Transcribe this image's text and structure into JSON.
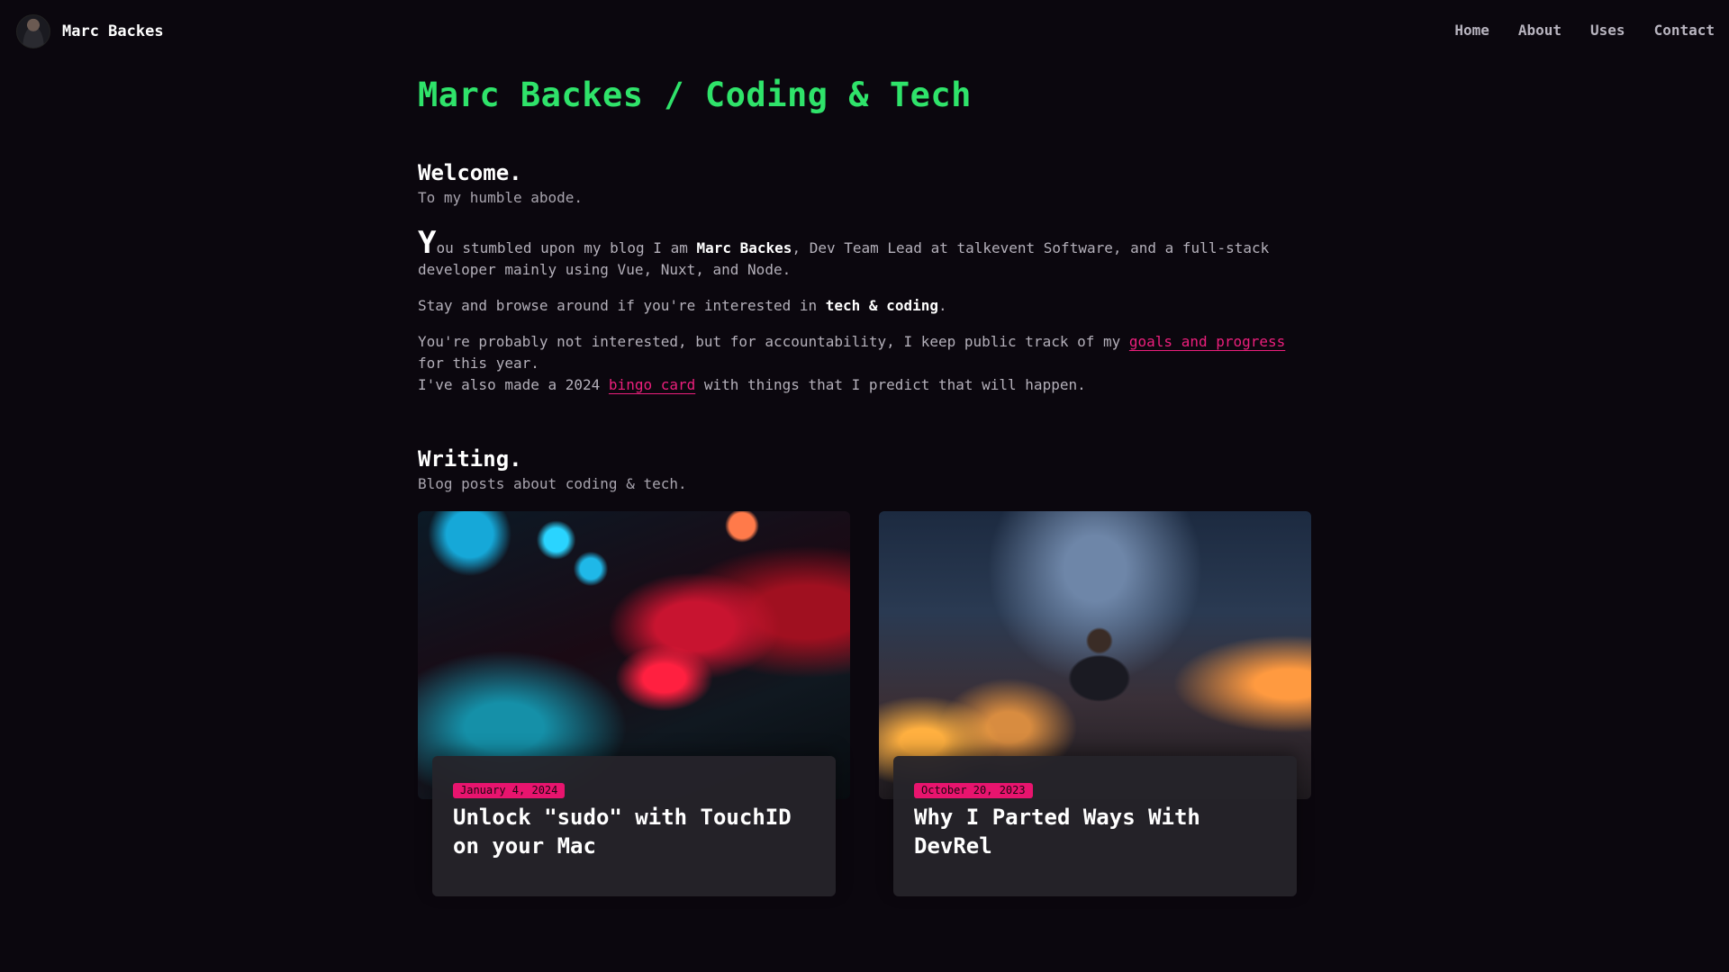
{
  "nav": {
    "brand_name": "Marc Backes",
    "links": [
      {
        "label": "Home"
      },
      {
        "label": "About"
      },
      {
        "label": "Uses"
      },
      {
        "label": "Contact"
      }
    ]
  },
  "header": {
    "title": "Marc Backes / Coding & Tech"
  },
  "welcome": {
    "title": "Welcome.",
    "subtitle": "To my humble abode."
  },
  "intro": {
    "dropcap": "Y",
    "p1_start": "ou stumbled upon my blog I am ",
    "p1_name": "Marc Backes",
    "p1_end": ", Dev Team Lead at talkevent Software, and a full-stack developer mainly using Vue, Nuxt, and Node.",
    "p2_start": "Stay and browse around if you're interested in ",
    "p2_bold": "tech & coding",
    "p2_end": ".",
    "p3_start": "You're probably not interested, but for accountability, I keep public track of my ",
    "p3_link": "goals and progress",
    "p3_end": " for this year.",
    "p4_start": "I've also made a 2024 ",
    "p4_link": "bingo card",
    "p4_end": " with things that I predict that will happen."
  },
  "writing": {
    "title": "Writing.",
    "subtitle": "Blog posts about coding & tech.",
    "posts": [
      {
        "date": "January 4, 2024",
        "title": "Unlock \"sudo\" with TouchID on your Mac"
      },
      {
        "date": "October 20, 2023",
        "title": "Why I Parted Ways With DevRel"
      }
    ]
  },
  "colors": {
    "background": "#0b070e",
    "accent_green": "#2fe36a",
    "accent_pink": "#e8146e"
  }
}
